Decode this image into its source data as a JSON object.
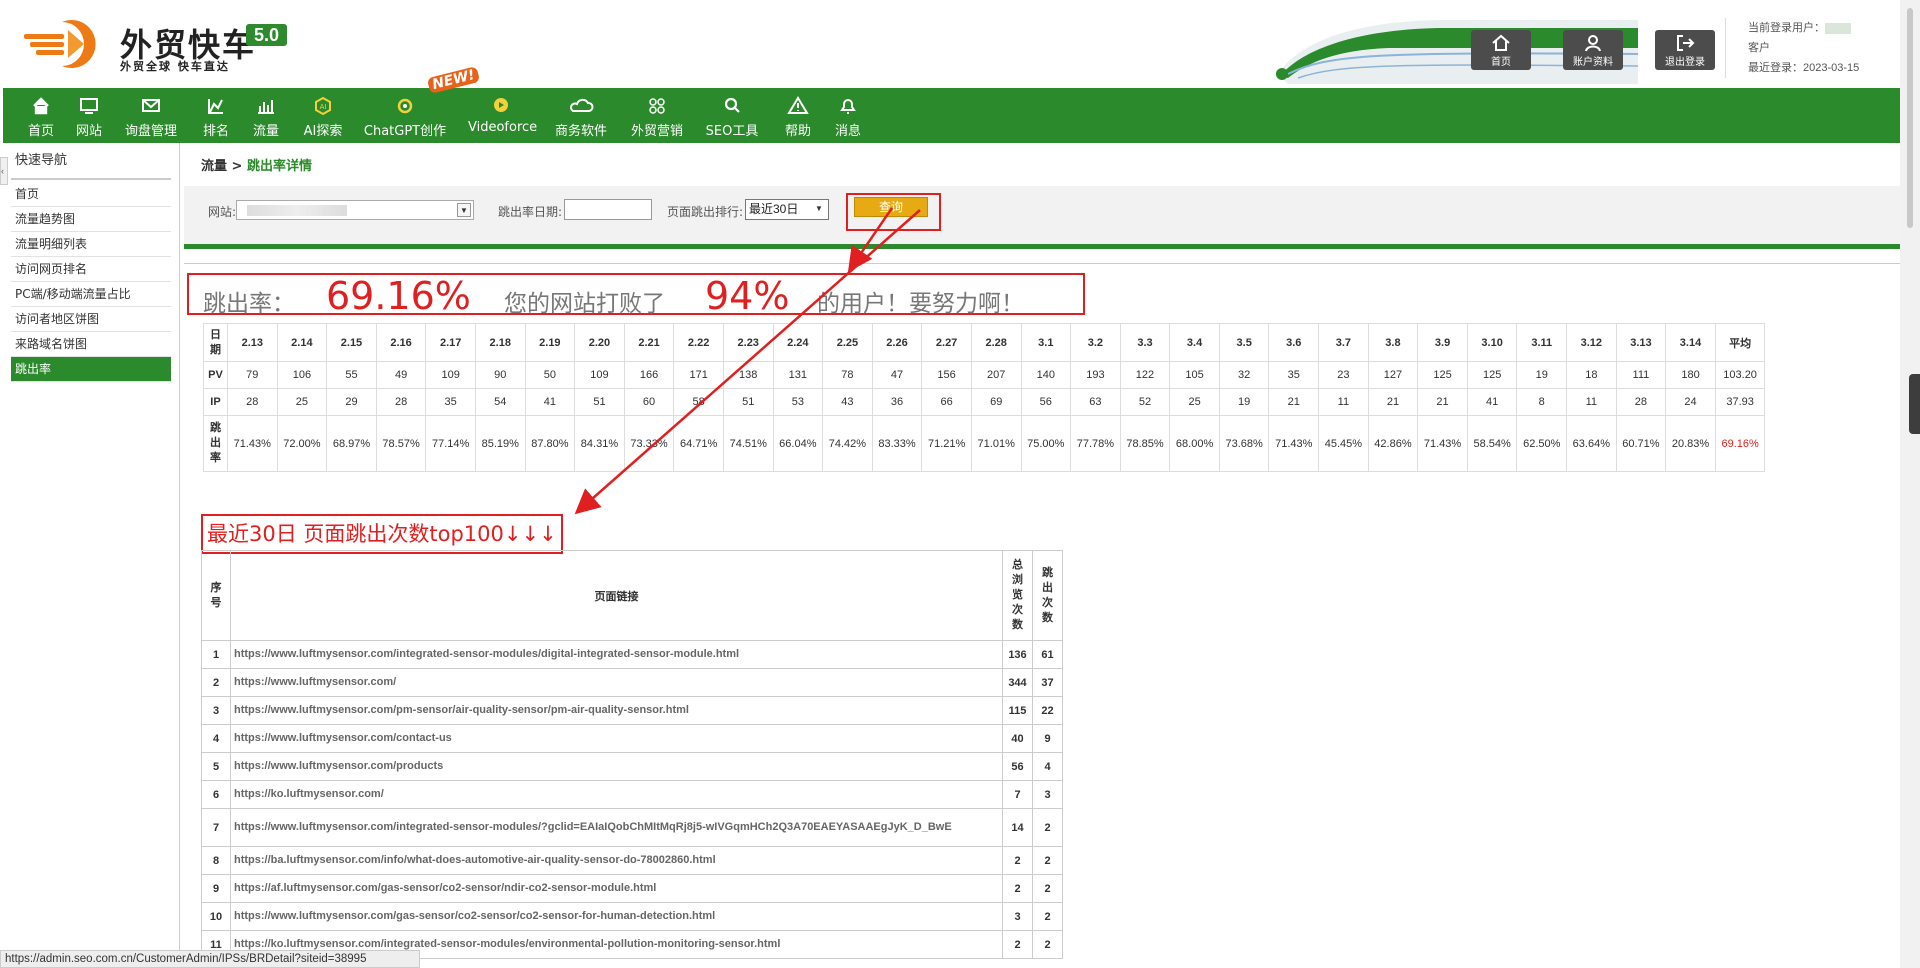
{
  "header": {
    "logo_name": "外贸快车",
    "logo_version": "5.0",
    "logo_slogan": "外贸全球 快车直达",
    "buttons": {
      "home": "首页",
      "account": "账户资料",
      "logout": "退出登录"
    },
    "user_label": "当前登录用户：",
    "user_role": "客户",
    "last_login": "最近登录：2023-03-15"
  },
  "nav": {
    "items": [
      "首页",
      "网站",
      "询盘管理",
      "排名",
      "流量",
      "AI探索",
      "ChatGPT创作",
      "Videoforce",
      "商务软件",
      "外贸营销",
      "SEO工具",
      "帮助",
      "消息"
    ],
    "new_badge": "NEW!"
  },
  "sidebar": {
    "title": "快速导航",
    "items": [
      "首页",
      "流量趋势图",
      "流量明细列表",
      "访问网页排名",
      "PC端/移动端流量占比",
      "访问者地区饼图",
      "来路域名饼图",
      "跳出率"
    ]
  },
  "breadcrumb": {
    "parent": "流量",
    "sep": " > ",
    "current": "跳出率详情"
  },
  "filter": {
    "site_label": "网站:",
    "date_label": "跳出率日期:",
    "rank_label": "页面跳出排行:",
    "rank_value": "最近30日",
    "query_button": "查询"
  },
  "summary": {
    "prefix": "跳出率：",
    "rate": "69.16%",
    "mid": "您的网站打败了",
    "beat": "94%",
    "suffix": "的用户！要努力啊！"
  },
  "stats": {
    "row_labels": {
      "date": "日期",
      "pv": "PV",
      "ip": "IP",
      "bounce": "跳出率"
    },
    "dates": [
      "2.13",
      "2.14",
      "2.15",
      "2.16",
      "2.17",
      "2.18",
      "2.19",
      "2.20",
      "2.21",
      "2.22",
      "2.23",
      "2.24",
      "2.25",
      "2.26",
      "2.27",
      "2.28",
      "3.1",
      "3.2",
      "3.3",
      "3.4",
      "3.5",
      "3.6",
      "3.7",
      "3.8",
      "3.9",
      "3.10",
      "3.11",
      "3.12",
      "3.13",
      "3.14",
      "平均"
    ],
    "pv": [
      "79",
      "106",
      "55",
      "49",
      "109",
      "90",
      "50",
      "109",
      "166",
      "171",
      "138",
      "131",
      "78",
      "47",
      "156",
      "207",
      "140",
      "193",
      "122",
      "105",
      "32",
      "35",
      "23",
      "127",
      "125",
      "125",
      "19",
      "18",
      "111",
      "180",
      "103.20"
    ],
    "ip": [
      "28",
      "25",
      "29",
      "28",
      "35",
      "54",
      "41",
      "51",
      "60",
      "58",
      "51",
      "53",
      "43",
      "36",
      "66",
      "69",
      "56",
      "63",
      "52",
      "25",
      "19",
      "21",
      "11",
      "21",
      "21",
      "41",
      "8",
      "11",
      "28",
      "24",
      "37.93"
    ],
    "bounce": [
      "71.43%",
      "72.00%",
      "68.97%",
      "78.57%",
      "77.14%",
      "85.19%",
      "87.80%",
      "84.31%",
      "73.33%",
      "64.71%",
      "74.51%",
      "66.04%",
      "74.42%",
      "83.33%",
      "71.21%",
      "71.01%",
      "75.00%",
      "77.78%",
      "78.85%",
      "68.00%",
      "73.68%",
      "71.43%",
      "45.45%",
      "42.86%",
      "71.43%",
      "58.54%",
      "62.50%",
      "63.64%",
      "60.71%",
      "20.83%",
      "69.16%"
    ]
  },
  "top100_title": "最近30日 页面跳出次数top100↓↓↓",
  "pages_table": {
    "headers": {
      "index": "序号",
      "url": "页面链接",
      "views": "总浏览次数",
      "bounces": "跳出次数"
    },
    "rows": [
      {
        "idx": "1",
        "url": "https://www.luftmysensor.com/integrated-sensor-modules/digital-integrated-sensor-module.html",
        "views": "136",
        "bounces": "61"
      },
      {
        "idx": "2",
        "url": "https://www.luftmysensor.com/",
        "views": "344",
        "bounces": "37"
      },
      {
        "idx": "3",
        "url": "https://www.luftmysensor.com/pm-sensor/air-quality-sensor/pm-air-quality-sensor.html",
        "views": "115",
        "bounces": "22"
      },
      {
        "idx": "4",
        "url": "https://www.luftmysensor.com/contact-us",
        "views": "40",
        "bounces": "9"
      },
      {
        "idx": "5",
        "url": "https://www.luftmysensor.com/products",
        "views": "56",
        "bounces": "4"
      },
      {
        "idx": "6",
        "url": "https://ko.luftmysensor.com/",
        "views": "7",
        "bounces": "3"
      },
      {
        "idx": "7",
        "url": "https://www.luftmysensor.com/integrated-sensor-modules/?gclid=EAIaIQobChMItMqRj8j5-wIVGqmHCh2Q3A70EAEYASAAEgJyK_D_BwE",
        "views": "14",
        "bounces": "2"
      },
      {
        "idx": "8",
        "url": "https://ba.luftmysensor.com/info/what-does-automotive-air-quality-sensor-do-78002860.html",
        "views": "2",
        "bounces": "2"
      },
      {
        "idx": "9",
        "url": "https://af.luftmysensor.com/gas-sensor/co2-sensor/ndir-co2-sensor-module.html",
        "views": "2",
        "bounces": "2"
      },
      {
        "idx": "10",
        "url": "https://www.luftmysensor.com/gas-sensor/co2-sensor/co2-sensor-for-human-detection.html",
        "views": "3",
        "bounces": "2"
      },
      {
        "idx": "11",
        "url": "https://ko.luftmysensor.com/integrated-sensor-modules/environmental-pollution-monitoring-sensor.html",
        "views": "2",
        "bounces": "2"
      }
    ]
  },
  "status_url": "https://admin.seo.com.cn/CustomerAdmin/IPSs/BRDetail?siteid=38995",
  "colors": {
    "brand_green": "#2b8a2b",
    "alert_red": "#e02020",
    "query_yellow": "#e8aa12"
  }
}
